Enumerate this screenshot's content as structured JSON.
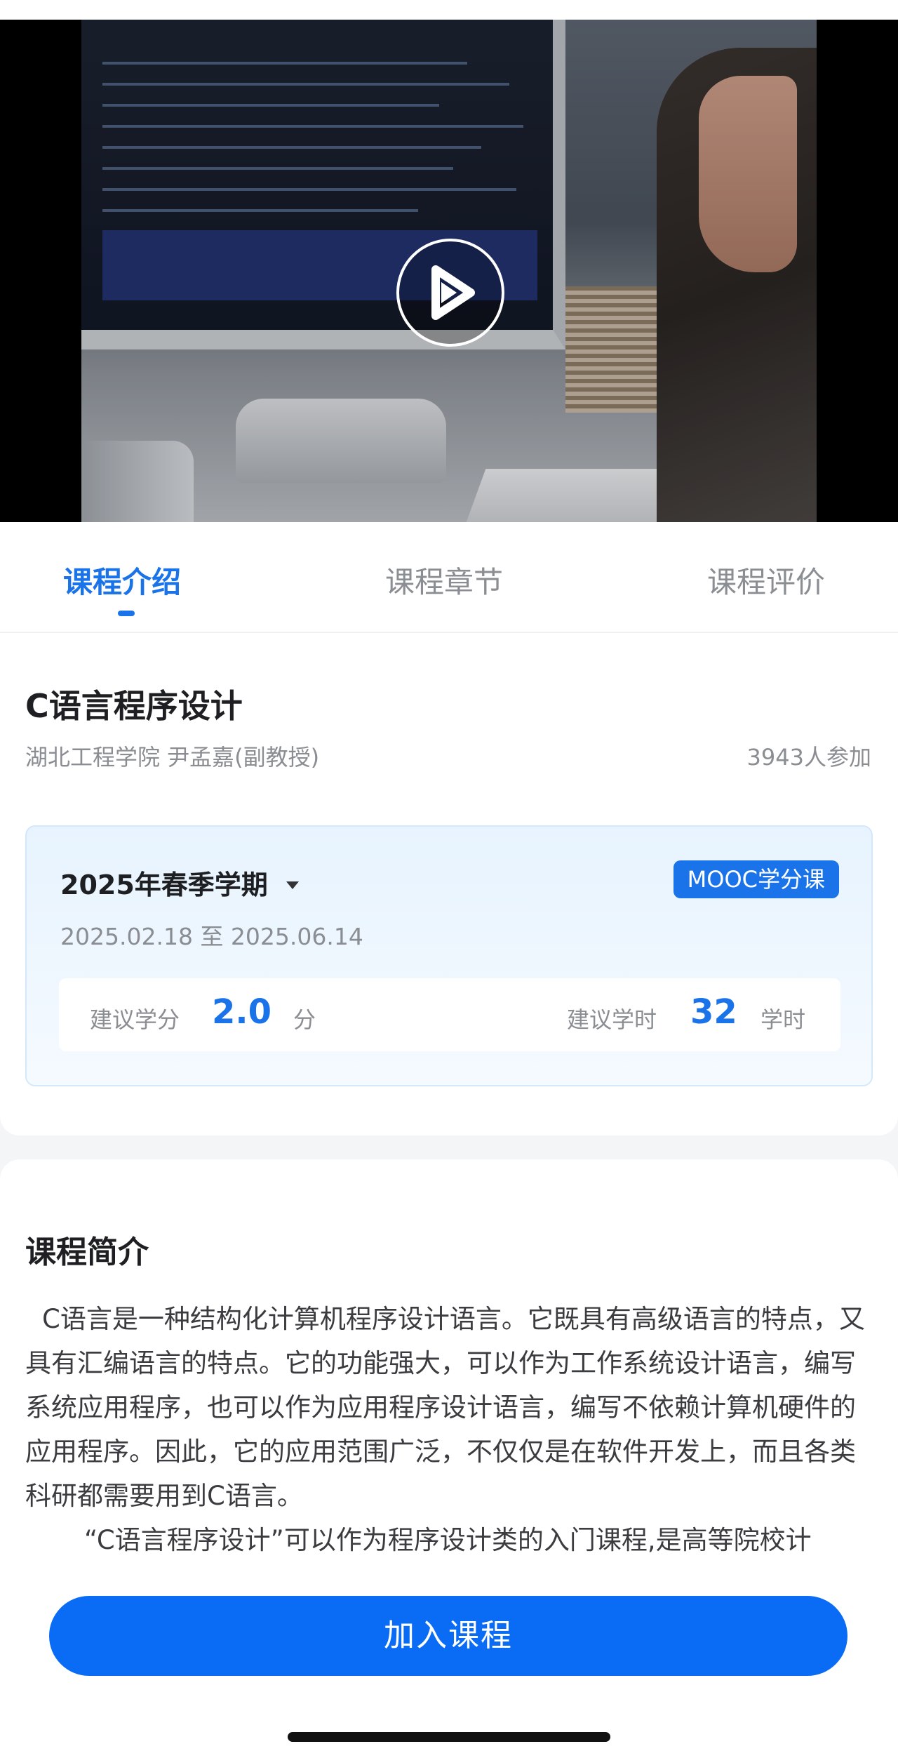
{
  "video": {
    "play_icon": "play-icon"
  },
  "tabs": [
    {
      "label": "课程介绍",
      "active": true
    },
    {
      "label": "课程章节",
      "active": false
    },
    {
      "label": "课程评价",
      "active": false
    }
  ],
  "course": {
    "title": "C语言程序设计",
    "teacher": "湖北工程学院 尹孟嘉(副教授)",
    "participants": "3943人参加"
  },
  "term": {
    "selected": "2025年春季学期",
    "badge": "MOOC学分课",
    "dates": "2025.02.18 至 2025.06.14",
    "credit_label": "建议学分",
    "credit_value": "2.0",
    "credit_unit": "分",
    "hours_label": "建议学时",
    "hours_value": "32",
    "hours_unit": "学时"
  },
  "intro": {
    "title": "课程简介",
    "paragraph1": "C语言是一种结构化计算机程序设计语言。它既具有高级语言的特点，又具有汇编语言的特点。它的功能强大，可以作为工作系统设计语言，编写系统应用程序，也可以作为应用程序设计语言，编写不依赖计算机硬件的应用程序。因此，它的应用范围广泛，不仅仅是在软件开发上，而且各类科研都需要用到C语言。",
    "paragraph2": "“C语言程序设计”可以作为程序设计类的入门课程,是高等院校计"
  },
  "actions": {
    "join_label": "加入课程"
  },
  "colors": {
    "accent": "#1a73e8",
    "button": "#0a6cf5"
  }
}
